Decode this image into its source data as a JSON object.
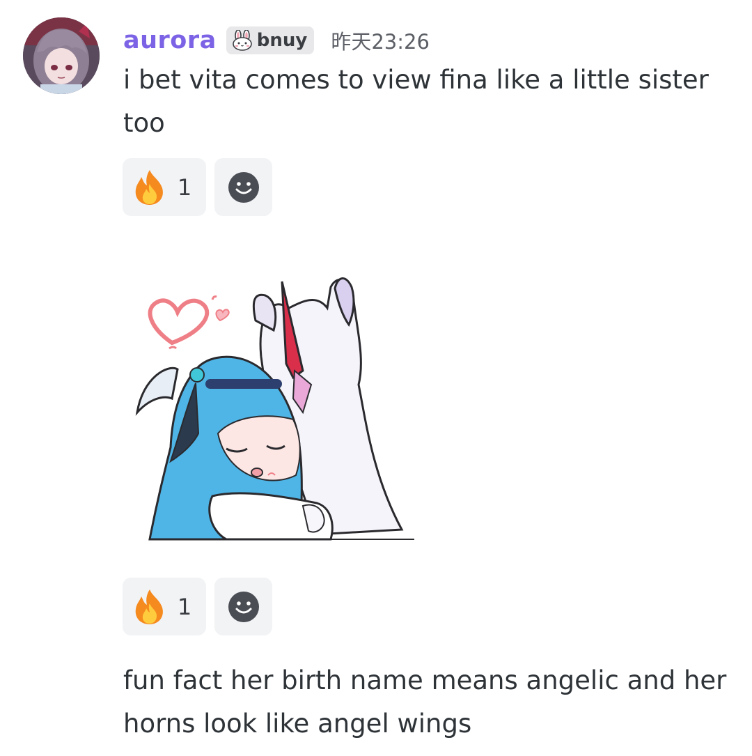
{
  "message": {
    "author": "aurora",
    "role_tag": "bnuy",
    "timestamp": "昨天23:26",
    "text": "i bet vita comes to view fina like a little sister too",
    "reactions": [
      {
        "emoji": "fire-icon",
        "count": "1"
      }
    ]
  },
  "sticker": {
    "reactions": [
      {
        "emoji": "fire-icon",
        "count": "1"
      }
    ]
  },
  "followup": {
    "text": "fun fact her birth name means angelic and her horns look like angel wings"
  },
  "colors": {
    "username": "#7c63e6",
    "reaction_bg": "#f2f3f5",
    "role_tag_bg": "#e8e8ea"
  }
}
